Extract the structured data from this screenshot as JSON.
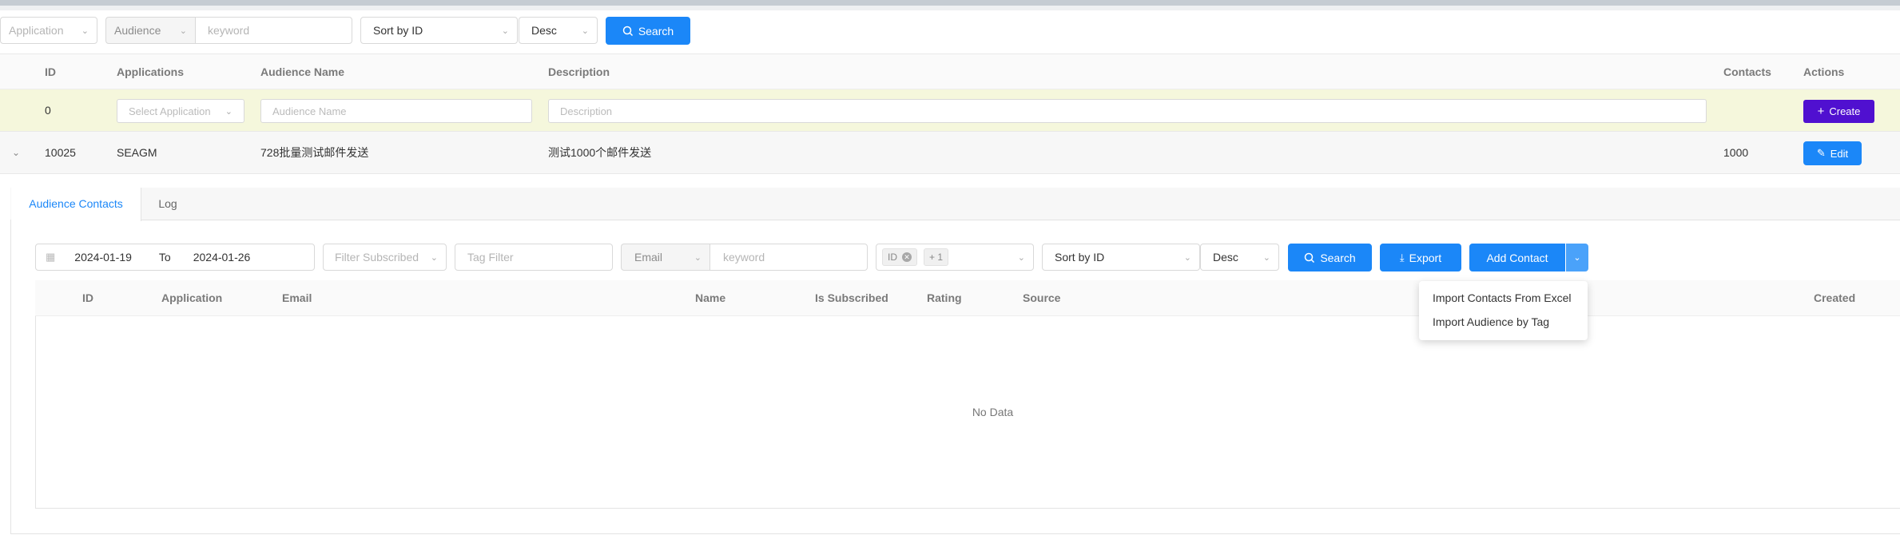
{
  "filters": {
    "application_placeholder": "Application",
    "audience_label": "Audience",
    "keyword_placeholder": "keyword",
    "sort_value": "Sort by ID",
    "order_value": "Desc",
    "search_label": "Search"
  },
  "table": {
    "headers": {
      "id": "ID",
      "applications": "Applications",
      "audience_name": "Audience Name",
      "description": "Description",
      "contacts": "Contacts",
      "actions": "Actions"
    },
    "create_row": {
      "id": "0",
      "application_placeholder": "Select Application",
      "name_placeholder": "Audience Name",
      "description_placeholder": "Description",
      "create_label": "Create"
    },
    "rows": [
      {
        "id": "10025",
        "application": "SEAGM",
        "name": "728批量测试邮件发送",
        "description": "测试1000个邮件发送",
        "contacts": "1000",
        "edit_label": "Edit"
      }
    ]
  },
  "detail": {
    "tabs": [
      {
        "label": "Audience Contacts",
        "active": true
      },
      {
        "label": "Log",
        "active": false
      }
    ],
    "toolbar": {
      "date_from": "2024-01-19",
      "date_to_label": "To",
      "date_to": "2024-01-26",
      "subscribed_placeholder": "Filter Subscribed",
      "tag_placeholder": "Tag Filter",
      "field_select": "Email",
      "keyword_placeholder": "keyword",
      "chip_id": "ID",
      "chip_more": "+ 1",
      "sort_value": "Sort by ID",
      "order_value": "Desc",
      "search_label": "Search",
      "export_label": "Export",
      "add_contact_label": "Add Contact"
    },
    "columns": [
      "ID",
      "Application",
      "Email",
      "Name",
      "Is Subscribed",
      "Rating",
      "Source",
      "Created"
    ],
    "empty_text": "No Data",
    "add_menu": [
      "Import Contacts From Excel",
      "Import Audience by Tag"
    ]
  },
  "colors": {
    "primary": "#1b87f8",
    "create": "#5010d0",
    "create_row_bg": "#f5f7dc"
  }
}
